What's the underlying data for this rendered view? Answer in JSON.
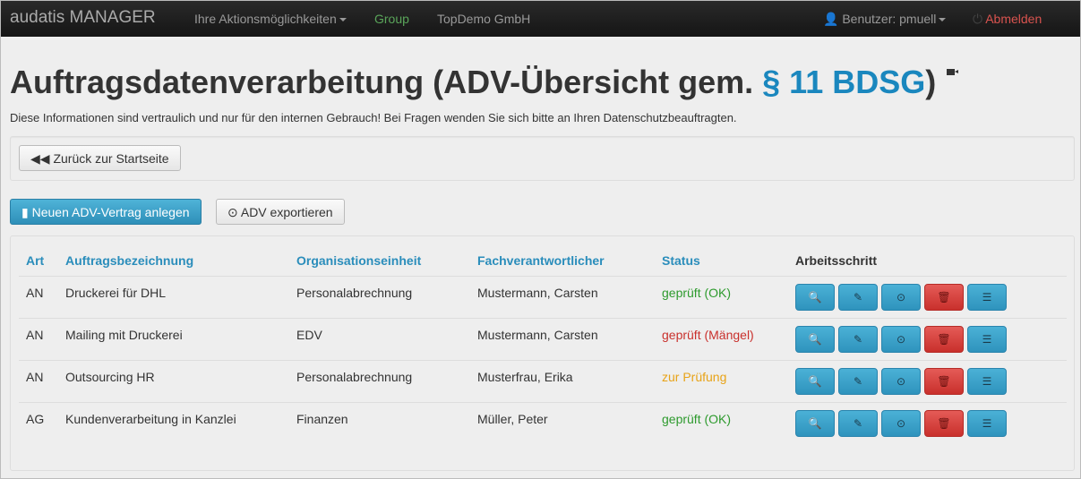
{
  "navbar": {
    "brand": "audatis MANAGER",
    "actions_menu": "Ihre Aktionsmöglichkeiten",
    "group": "Group",
    "company": "TopDemo GmbH",
    "user": "Benutzer: pmuell",
    "logout": "Abmelden"
  },
  "page": {
    "title_part1": "Auftragsdatenverarbeitung (ADV-Übersicht gem. ",
    "title_highlight": "§ 11 BDSG",
    "title_part2": ")",
    "subtitle": "Diese Informationen sind vertraulich und nur für den internen Gebrauch! Bei Fragen wenden Sie sich bitte an Ihren Datenschutzbeauftragten."
  },
  "buttons": {
    "back": "Zurück zur Startseite",
    "new": "Neuen ADV-Vertrag anlegen",
    "export": "ADV exportieren"
  },
  "table": {
    "headers": [
      "Art",
      "Auftragsbezeichnung",
      "Organisationseinheit",
      "Fachverantwortlicher",
      "Status",
      "Arbeitsschritt"
    ],
    "rows": [
      {
        "art": "AN",
        "name": "Druckerei für DHL",
        "org": "Personalabrechnung",
        "owner": "Mustermann, Carsten",
        "status": "geprüft (OK)",
        "status_color": "#2d9a2d"
      },
      {
        "art": "AN",
        "name": "Mailing mit Druckerei",
        "org": "EDV",
        "owner": "Mustermann, Carsten",
        "status": "geprüft (Mängel)",
        "status_color": "#c9302c"
      },
      {
        "art": "AN",
        "name": "Outsourcing HR",
        "org": "Personalabrechnung",
        "owner": "Musterfrau, Erika",
        "status": "zur Prüfung",
        "status_color": "#e8a317"
      },
      {
        "art": "AG",
        "name": "Kundenverarbeitung in Kanzlei",
        "org": "Finanzen",
        "owner": "Müller, Peter",
        "status": "geprüft (OK)",
        "status_color": "#2d9a2d"
      }
    ]
  },
  "colors": {
    "navbar": "#1b1b1b",
    "group": "#5aa55a",
    "logout": "#d9534f",
    "accent": "#1a87be"
  }
}
